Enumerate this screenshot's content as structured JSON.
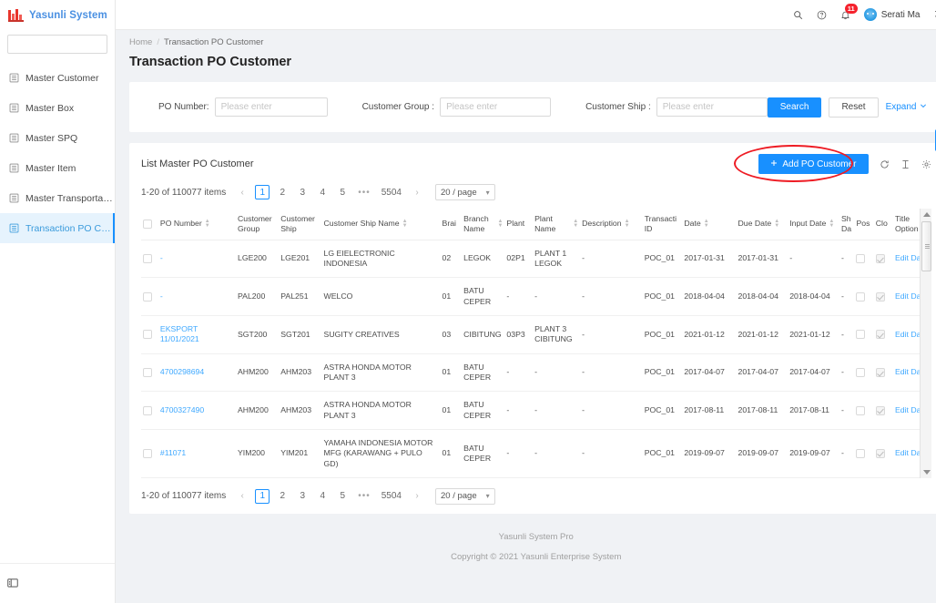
{
  "brand": {
    "name": "Yasunli System",
    "logo_icon": "bar-logo-icon"
  },
  "sidebar": {
    "search_placeholder": "",
    "search_value": "",
    "search_icon": "search-icon",
    "items": [
      {
        "label": "Master Customer",
        "icon": "list-icon",
        "active": false
      },
      {
        "label": "Master Box",
        "icon": "list-icon",
        "active": false
      },
      {
        "label": "Master SPQ",
        "icon": "list-icon",
        "active": false
      },
      {
        "label": "Master Item",
        "icon": "list-icon",
        "active": false
      },
      {
        "label": "Master Transportation",
        "icon": "list-icon",
        "active": false
      },
      {
        "label": "Transaction PO Custo...",
        "icon": "list-icon",
        "active": true
      }
    ],
    "collapse_icon": "menu-fold-icon"
  },
  "topbar": {
    "search_icon": "search-icon",
    "help_icon": "question-circle-icon",
    "bell_icon": "bell-icon",
    "notification_count": "11",
    "avatar_icon": "avatar",
    "user_name": "Serati Ma",
    "translate_icon": "translate-icon"
  },
  "breadcrumb": {
    "home": "Home",
    "separator": "/",
    "current": "Transaction PO Customer"
  },
  "page": {
    "title": "Transaction PO Customer"
  },
  "filters": {
    "po_number": {
      "label": "PO Number:",
      "placeholder": "Please enter",
      "value": ""
    },
    "customer_group": {
      "label": "Customer Group :",
      "placeholder": "Please enter",
      "value": ""
    },
    "customer_ship": {
      "label": "Customer Ship :",
      "placeholder": "Please enter",
      "value": ""
    },
    "search_button": "Search",
    "reset_button": "Reset",
    "expand_link": "Expand",
    "expand_icon": "chevron-down-icon"
  },
  "list": {
    "title": "List Master PO Customer",
    "add_button": "Add PO Customer",
    "add_icon": "plus-icon",
    "reload_icon": "reload-icon",
    "density_icon": "column-height-icon",
    "settings_icon": "gear-icon"
  },
  "pagination": {
    "summary": "1-20 of 110077 items",
    "prev_icon": "chevron-left-icon",
    "next_icon": "chevron-right-icon",
    "pages": [
      "1",
      "2",
      "3",
      "4",
      "5"
    ],
    "ellipsis": "•••",
    "last_page": "5504",
    "current_page": "1",
    "page_size": "20 / page",
    "page_size_icon": "chevron-down-icon"
  },
  "floating": {
    "settings_icon": "gear-icon"
  },
  "table": {
    "columns": [
      {
        "key": "checkbox",
        "label": "",
        "sortable": false
      },
      {
        "key": "po_number",
        "label": "PO Number",
        "sortable": true
      },
      {
        "key": "customer_group",
        "label": "Customer Group",
        "sortable": false
      },
      {
        "key": "customer_ship",
        "label": "Customer Ship",
        "sortable": false
      },
      {
        "key": "customer_ship_name",
        "label": "Customer Ship Name",
        "sortable": true
      },
      {
        "key": "branch",
        "label": "Brai",
        "sortable": false
      },
      {
        "key": "branch_name",
        "label": "Branch Name",
        "sortable": true
      },
      {
        "key": "plant",
        "label": "Plant",
        "sortable": false
      },
      {
        "key": "plant_name",
        "label": "Plant Name",
        "sortable": true
      },
      {
        "key": "description",
        "label": "Description",
        "sortable": true
      },
      {
        "key": "transaction_id",
        "label": "Transacti ID",
        "sortable": false
      },
      {
        "key": "date",
        "label": "Date",
        "sortable": true
      },
      {
        "key": "due_date",
        "label": "Due Date",
        "sortable": true
      },
      {
        "key": "input_date",
        "label": "Input Date",
        "sortable": true
      },
      {
        "key": "ship_date",
        "label": "Sh Da",
        "sortable": false
      },
      {
        "key": "pos",
        "label": "Pos",
        "sortable": false
      },
      {
        "key": "clo",
        "label": "Clo",
        "sortable": false
      },
      {
        "key": "title_option",
        "label": "Title Option",
        "sortable": false
      }
    ],
    "rows": [
      {
        "po_number": "-",
        "po_link": true,
        "customer_group": "LGE200",
        "customer_ship": "LGE201",
        "customer_ship_name": "LG EIELECTRONIC INDONESIA",
        "branch": "02",
        "branch_name": "LEGOK",
        "plant": "02P1",
        "plant_name": "PLANT 1 LEGOK",
        "description": "-",
        "transaction_id": "POC_01",
        "date": "2017-01-31",
        "due_date": "2017-01-31",
        "input_date": "-",
        "ship_date": "-",
        "pos_checked": false,
        "clo_checked": true,
        "title_option": "Edit Data"
      },
      {
        "po_number": "-",
        "po_link": true,
        "customer_group": "PAL200",
        "customer_ship": "PAL251",
        "customer_ship_name": "WELCO",
        "branch": "01",
        "branch_name": "BATU CEPER",
        "plant": "-",
        "plant_name": "-",
        "description": "-",
        "transaction_id": "POC_01",
        "date": "2018-04-04",
        "due_date": "2018-04-04",
        "input_date": "2018-04-04",
        "ship_date": "-",
        "pos_checked": false,
        "clo_checked": true,
        "title_option": "Edit Data"
      },
      {
        "po_number": "EKSPORT 11/01/2021",
        "po_link": true,
        "customer_group": "SGT200",
        "customer_ship": "SGT201",
        "customer_ship_name": "SUGITY CREATIVES",
        "branch": "03",
        "branch_name": "CIBITUNG",
        "plant": "03P3",
        "plant_name": "PLANT 3 CIBITUNG",
        "description": "-",
        "transaction_id": "POC_01",
        "date": "2021-01-12",
        "due_date": "2021-01-12",
        "input_date": "2021-01-12",
        "ship_date": "-",
        "pos_checked": false,
        "clo_checked": true,
        "title_option": "Edit Data"
      },
      {
        "po_number": "4700298694",
        "po_link": true,
        "customer_group": "AHM200",
        "customer_ship": "AHM203",
        "customer_ship_name": "ASTRA HONDA MOTOR PLANT 3",
        "branch": "01",
        "branch_name": "BATU CEPER",
        "plant": "-",
        "plant_name": "-",
        "description": "-",
        "transaction_id": "POC_01",
        "date": "2017-04-07",
        "due_date": "2017-04-07",
        "input_date": "2017-04-07",
        "ship_date": "-",
        "pos_checked": false,
        "clo_checked": true,
        "title_option": "Edit Data"
      },
      {
        "po_number": "4700327490",
        "po_link": true,
        "customer_group": "AHM200",
        "customer_ship": "AHM203",
        "customer_ship_name": "ASTRA HONDA MOTOR PLANT 3",
        "branch": "01",
        "branch_name": "BATU CEPER",
        "plant": "-",
        "plant_name": "-",
        "description": "-",
        "transaction_id": "POC_01",
        "date": "2017-08-11",
        "due_date": "2017-08-11",
        "input_date": "2017-08-11",
        "ship_date": "-",
        "pos_checked": false,
        "clo_checked": true,
        "title_option": "Edit Data"
      },
      {
        "po_number": "#11071",
        "po_link": true,
        "customer_group": "YIM200",
        "customer_ship": "YIM201",
        "customer_ship_name": "YAMAHA INDONESIA MOTOR MFG (KARAWANG + PULO GD)",
        "branch": "01",
        "branch_name": "BATU CEPER",
        "plant": "-",
        "plant_name": "-",
        "description": "-",
        "transaction_id": "POC_01",
        "date": "2019-09-07",
        "due_date": "2019-09-07",
        "input_date": "2019-09-07",
        "ship_date": "-",
        "pos_checked": false,
        "clo_checked": true,
        "title_option": "Edit Data"
      }
    ]
  },
  "pagination_bottom": {
    "summary": "1-20 of 110077 items",
    "pages": [
      "1",
      "2",
      "3",
      "4",
      "5"
    ],
    "ellipsis": "•••",
    "last_page": "5504",
    "page_size": "20 / page"
  },
  "footer": {
    "line1": "Yasunli System Pro",
    "line2": "Copyright © 2021 Yasunli Enterprise System"
  },
  "colors": {
    "primary": "#1890ff",
    "link": "#40a9ff",
    "highlight": "#ee1c24",
    "brand": "#4a90e2",
    "badge": "#f5222d"
  }
}
